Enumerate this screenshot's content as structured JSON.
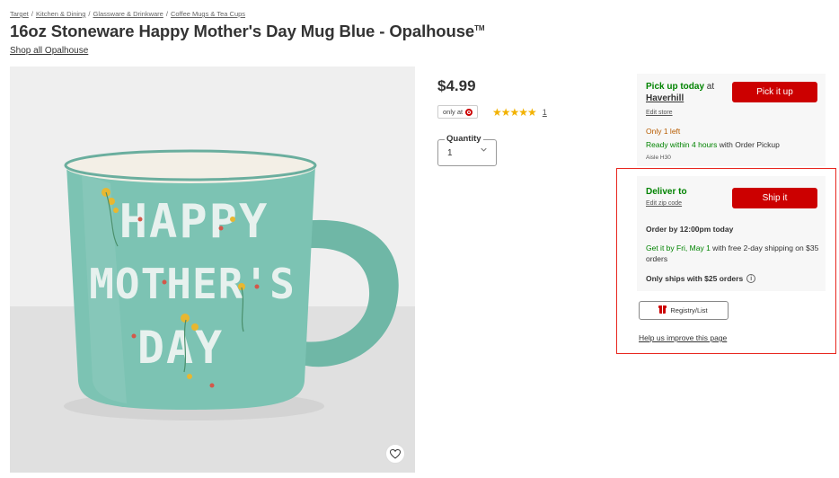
{
  "breadcrumb": [
    "Target",
    "Kitchen & Dining",
    "Glassware & Drinkware",
    "Coffee Mugs & Tea Cups"
  ],
  "breadcrumb_sep": "/",
  "product": {
    "title": "16oz Stoneware Happy Mother's Day Mug Blue - Opalhouse",
    "trademark": "TM",
    "shop_all": "Shop all Opalhouse",
    "price": "$4.99",
    "only_at": "only at",
    "rating_stars": "★★★★★",
    "rating_count": "1",
    "mug_text": [
      "HAPPY",
      "MOTHER'S",
      "DAY"
    ],
    "mug_color": "#7cc3b3"
  },
  "quantity": {
    "label": "Quantity",
    "value": "1"
  },
  "pickup": {
    "heading_bold": "Pick up today",
    "heading_at": " at",
    "store": "Haverhill",
    "edit_store": "Edit store",
    "only_left": "Only 1 left",
    "ready_green": "Ready within 4 hours",
    "ready_rest": " with Order Pickup",
    "aisle": "Aisle H30",
    "button": "Pick it up"
  },
  "delivery": {
    "heading": "Deliver to",
    "edit_zip": "Edit zip code",
    "order_by": "Order by 12:00pm today",
    "get_it_green": "Get it by Fri, May 1",
    "get_it_rest": " with free 2-day shipping on $35 orders",
    "only_ships": "Only ships with $25 orders",
    "info_glyph": "i",
    "button": "Ship it"
  },
  "registry": "Registry/List",
  "improve": "Help us improve this page",
  "colors": {
    "target_red": "#cc0000",
    "green": "#008300",
    "star": "#f2b200",
    "highlight": "#e8271f"
  }
}
